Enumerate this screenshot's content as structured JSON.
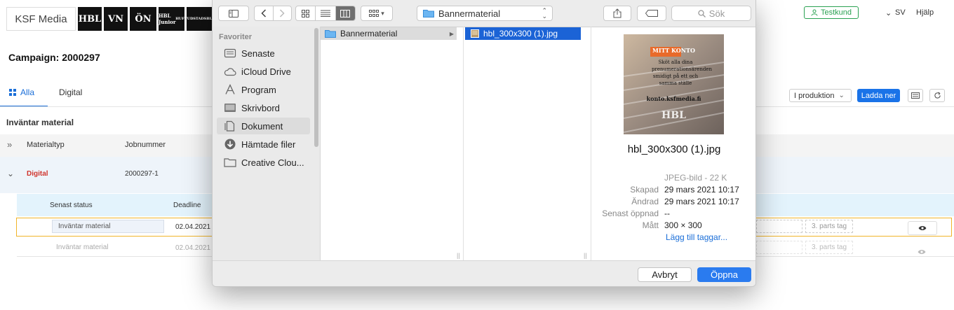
{
  "app": {
    "brand": "KSF Media",
    "logos": [
      "HBL",
      "VN",
      "ÖN",
      "HBL Junior",
      "HUFVUDSTADSBLADET"
    ],
    "testkund_label": "Testkund",
    "lang_label": "SV",
    "help_label": "Hjälp",
    "campaign_title": "Campaign: 2000297",
    "tabs": [
      {
        "label": "Alla"
      },
      {
        "label": "Digital"
      }
    ],
    "status_select": "I produktion",
    "download_label": "Ladda ner",
    "section_title": "Inväntar material",
    "table_headers": {
      "materialtyp": "Materialtyp",
      "jobbnummer": "Jobnummer"
    },
    "digital_row": {
      "type": "Digital",
      "job": "2000297-1"
    },
    "sub_headers": {
      "status": "Senast status",
      "deadline": "Deadline"
    },
    "rows": [
      {
        "status": "Inväntar material",
        "deadline": "02.04.2021",
        "tag": "3. parts tag"
      },
      {
        "status": "Inväntar material",
        "deadline": "02.04.2021",
        "tag": "3. parts tag"
      }
    ],
    "colors": {
      "accent": "#1a73e8",
      "testkund": "#2aa152",
      "digital_red": "#d0342c",
      "selected_border": "#f0b429"
    }
  },
  "dialog": {
    "path_label": "Bannermaterial",
    "search_placeholder": "Sök",
    "sidebar_heading": "Favoriter",
    "sidebar_items": [
      {
        "label": "Senaste",
        "icon": "recents-icon"
      },
      {
        "label": "iCloud Drive",
        "icon": "cloud-icon"
      },
      {
        "label": "Program",
        "icon": "applications-icon"
      },
      {
        "label": "Skrivbord",
        "icon": "desktop-icon"
      },
      {
        "label": "Dokument",
        "icon": "document-icon"
      },
      {
        "label": "Hämtade filer",
        "icon": "downloads-icon"
      },
      {
        "label": "Creative Clou...",
        "icon": "folder-icon"
      }
    ],
    "column1_folder": "Bannermaterial",
    "column2_file": "hbl_300x300 (1).jpg",
    "preview": {
      "banner_heading": "MITT KONTO",
      "banner_text": "Sköt alla dina prenumerationsärenden smidigt på ett och samma ställe",
      "banner_url": "konto.ksfmedia.fi",
      "banner_logo": "HBL",
      "filename": "hbl_300x300 (1).jpg",
      "kind": "JPEG-bild - 22 K",
      "meta": [
        {
          "k": "Skapad",
          "v": "29 mars 2021 10:17"
        },
        {
          "k": "Ändrad",
          "v": "29 mars 2021 10:17"
        },
        {
          "k": "Senast öppnad",
          "v": "--"
        },
        {
          "k": "Mått",
          "v": "300 × 300"
        }
      ],
      "add_tags": "Lägg till taggar..."
    },
    "cancel_label": "Avbryt",
    "open_label": "Öppna"
  }
}
